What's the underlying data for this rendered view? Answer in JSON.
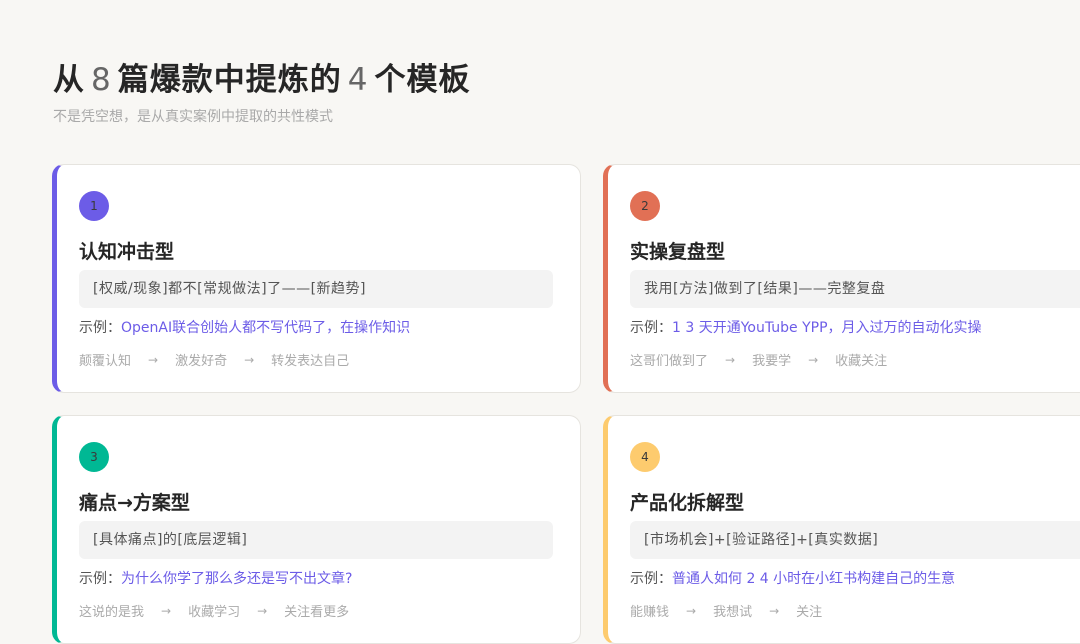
{
  "header": {
    "title_part1": "从",
    "title_num1": "8",
    "title_part2": "篇爆款中提炼的",
    "title_num2": "4",
    "title_part3": "个模板",
    "subtitle": "不是凭空想，是从真实案例中提取的共性模式"
  },
  "colors": {
    "card1": "#6c5ce7",
    "card2": "#e17055",
    "card3": "#00b894",
    "card4": "#fdcb6e",
    "example_link": "#6c5ce7"
  },
  "cards": [
    {
      "number": "1",
      "title": "认知冲击型",
      "formula": "[权威/现象]都不[常规做法]了——[新趋势]",
      "example_label": "示例：",
      "example_text": "OpenAI联合创始人都不写代码了，在操作知识",
      "flow": [
        "颠覆认知",
        "激发好奇",
        "转发表达自己"
      ],
      "arrow": "→"
    },
    {
      "number": "2",
      "title": "实操复盘型",
      "formula": "我用[方法]做到了[结果]——完整复盘",
      "example_label": "示例：",
      "example_text": "1 3 天开通YouTube  YPP，月入过万的自动化实操",
      "flow": [
        "这哥们做到了",
        "我要学",
        "收藏关注"
      ],
      "arrow": "→"
    },
    {
      "number": "3",
      "title": "痛点→方案型",
      "formula": "[具体痛点]的[底层逻辑]",
      "example_label": "示例：",
      "example_text": "为什么你学了那么多还是写不出文章?",
      "flow": [
        "这说的是我",
        "收藏学习",
        "关注看更多"
      ],
      "arrow": "→"
    },
    {
      "number": "4",
      "title": "产品化拆解型",
      "formula": "[市场机会]+[验证路径]+[真实数据]",
      "example_label": "示例：",
      "example_text": "普通人如何 2 4 小时在小红书构建自己的生意",
      "flow": [
        "能赚钱",
        "我想试",
        "关注"
      ],
      "arrow": "→"
    }
  ]
}
